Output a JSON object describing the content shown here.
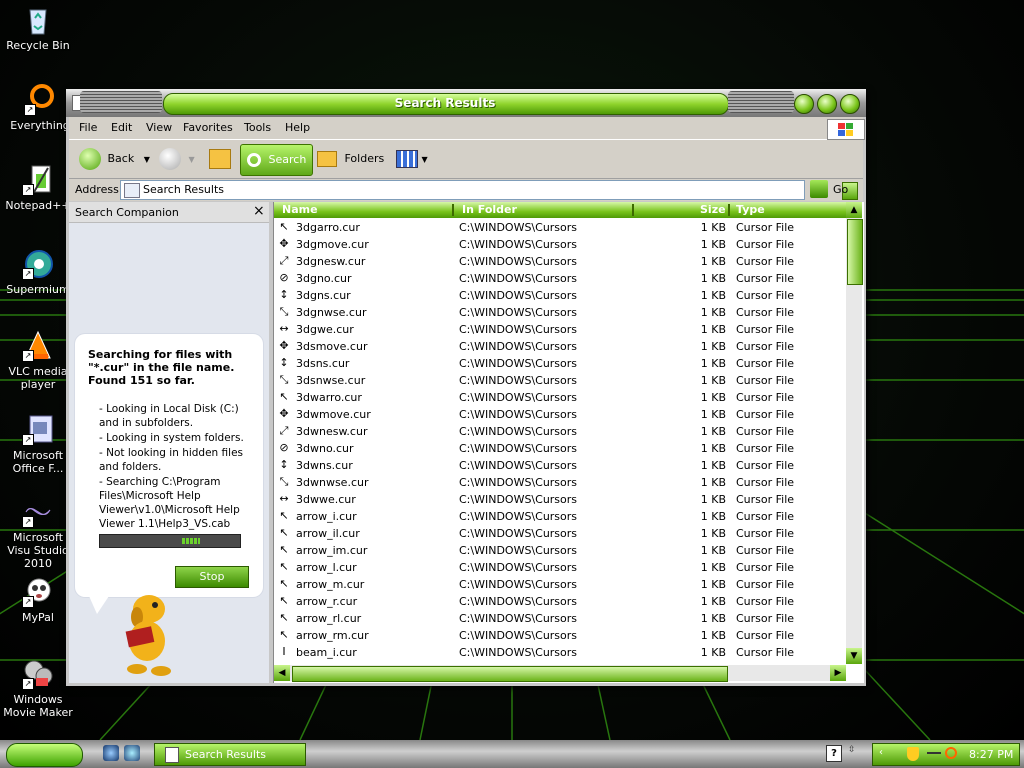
{
  "desktop": {
    "icons": [
      {
        "label": "Recycle Bin",
        "icon": "recycle-bin-icon"
      },
      {
        "label": "Everything",
        "icon": "everything-icon"
      },
      {
        "label": "Notepad++",
        "icon": "notepadpp-icon"
      },
      {
        "label": "Supermium",
        "icon": "supermium-icon"
      },
      {
        "label": "VLC media player",
        "icon": "vlc-icon"
      },
      {
        "label": "Microsoft Office F...",
        "icon": "office-icon"
      },
      {
        "label": "Microsoft Visu Studio 2010",
        "icon": "visual-studio-icon"
      },
      {
        "label": "MyPal",
        "icon": "mypal-icon"
      },
      {
        "label": "Windows Movie Maker",
        "icon": "movie-maker-icon"
      }
    ]
  },
  "window": {
    "title": "Search Results",
    "menu": [
      "File",
      "Edit",
      "View",
      "Favorites",
      "Tools",
      "Help"
    ],
    "toolbar": {
      "back": "Back",
      "search": "Search",
      "folders": "Folders"
    },
    "address": {
      "label": "Address",
      "value": "Search Results",
      "go": "Go"
    },
    "companion": {
      "title": "Search Companion",
      "close": "×",
      "heading": "Searching for files with \"*.cur\" in the file name. Found 151 so far.",
      "lines": [
        "- Looking in Local Disk (C:) and in subfolders.",
        "- Looking in system folders.",
        "- Not looking in hidden files and folders.",
        "- Searching C:\\Program Files\\Microsoft Help Viewer\\v1.0\\Microsoft Help Viewer 1.1\\Help3_VS.cab"
      ],
      "stop": "Stop"
    },
    "columns": [
      "Name",
      "In Folder",
      "Size",
      "Type"
    ],
    "files": [
      {
        "name": "3dgarro.cur",
        "folder": "C:\\WINDOWS\\Cursors",
        "size": "1 KB",
        "type": "Cursor File",
        "glyph": "↖"
      },
      {
        "name": "3dgmove.cur",
        "folder": "C:\\WINDOWS\\Cursors",
        "size": "1 KB",
        "type": "Cursor File",
        "glyph": "✥"
      },
      {
        "name": "3dgnesw.cur",
        "folder": "C:\\WINDOWS\\Cursors",
        "size": "1 KB",
        "type": "Cursor File",
        "glyph": "⤢"
      },
      {
        "name": "3dgno.cur",
        "folder": "C:\\WINDOWS\\Cursors",
        "size": "1 KB",
        "type": "Cursor File",
        "glyph": "⊘"
      },
      {
        "name": "3dgns.cur",
        "folder": "C:\\WINDOWS\\Cursors",
        "size": "1 KB",
        "type": "Cursor File",
        "glyph": "↕"
      },
      {
        "name": "3dgnwse.cur",
        "folder": "C:\\WINDOWS\\Cursors",
        "size": "1 KB",
        "type": "Cursor File",
        "glyph": "⤡"
      },
      {
        "name": "3dgwe.cur",
        "folder": "C:\\WINDOWS\\Cursors",
        "size": "1 KB",
        "type": "Cursor File",
        "glyph": "↔"
      },
      {
        "name": "3dsmove.cur",
        "folder": "C:\\WINDOWS\\Cursors",
        "size": "1 KB",
        "type": "Cursor File",
        "glyph": "✥"
      },
      {
        "name": "3dsns.cur",
        "folder": "C:\\WINDOWS\\Cursors",
        "size": "1 KB",
        "type": "Cursor File",
        "glyph": "↕"
      },
      {
        "name": "3dsnwse.cur",
        "folder": "C:\\WINDOWS\\Cursors",
        "size": "1 KB",
        "type": "Cursor File",
        "glyph": "⤡"
      },
      {
        "name": "3dwarro.cur",
        "folder": "C:\\WINDOWS\\Cursors",
        "size": "1 KB",
        "type": "Cursor File",
        "glyph": "↖"
      },
      {
        "name": "3dwmove.cur",
        "folder": "C:\\WINDOWS\\Cursors",
        "size": "1 KB",
        "type": "Cursor File",
        "glyph": "✥"
      },
      {
        "name": "3dwnesw.cur",
        "folder": "C:\\WINDOWS\\Cursors",
        "size": "1 KB",
        "type": "Cursor File",
        "glyph": "⤢"
      },
      {
        "name": "3dwno.cur",
        "folder": "C:\\WINDOWS\\Cursors",
        "size": "1 KB",
        "type": "Cursor File",
        "glyph": "⊘"
      },
      {
        "name": "3dwns.cur",
        "folder": "C:\\WINDOWS\\Cursors",
        "size": "1 KB",
        "type": "Cursor File",
        "glyph": "↕"
      },
      {
        "name": "3dwnwse.cur",
        "folder": "C:\\WINDOWS\\Cursors",
        "size": "1 KB",
        "type": "Cursor File",
        "glyph": "⤡"
      },
      {
        "name": "3dwwe.cur",
        "folder": "C:\\WINDOWS\\Cursors",
        "size": "1 KB",
        "type": "Cursor File",
        "glyph": "↔"
      },
      {
        "name": "arrow_i.cur",
        "folder": "C:\\WINDOWS\\Cursors",
        "size": "1 KB",
        "type": "Cursor File",
        "glyph": "↖"
      },
      {
        "name": "arrow_il.cur",
        "folder": "C:\\WINDOWS\\Cursors",
        "size": "1 KB",
        "type": "Cursor File",
        "glyph": "↖"
      },
      {
        "name": "arrow_im.cur",
        "folder": "C:\\WINDOWS\\Cursors",
        "size": "1 KB",
        "type": "Cursor File",
        "glyph": "↖"
      },
      {
        "name": "arrow_l.cur",
        "folder": "C:\\WINDOWS\\Cursors",
        "size": "1 KB",
        "type": "Cursor File",
        "glyph": "↖"
      },
      {
        "name": "arrow_m.cur",
        "folder": "C:\\WINDOWS\\Cursors",
        "size": "1 KB",
        "type": "Cursor File",
        "glyph": "↖"
      },
      {
        "name": "arrow_r.cur",
        "folder": "C:\\WINDOWS\\Cursors",
        "size": "1 KB",
        "type": "Cursor File",
        "glyph": "↖"
      },
      {
        "name": "arrow_rl.cur",
        "folder": "C:\\WINDOWS\\Cursors",
        "size": "1 KB",
        "type": "Cursor File",
        "glyph": "↖"
      },
      {
        "name": "arrow_rm.cur",
        "folder": "C:\\WINDOWS\\Cursors",
        "size": "1 KB",
        "type": "Cursor File",
        "glyph": "↖"
      },
      {
        "name": "beam_i.cur",
        "folder": "C:\\WINDOWS\\Cursors",
        "size": "1 KB",
        "type": "Cursor File",
        "glyph": "I"
      }
    ]
  },
  "taskbar": {
    "task": "Search Results",
    "help": "?",
    "clock": "8:27 PM"
  },
  "colors": {
    "accent": "#6bb31a",
    "accent_dark": "#3d7300",
    "title_text": "#ffffff"
  }
}
